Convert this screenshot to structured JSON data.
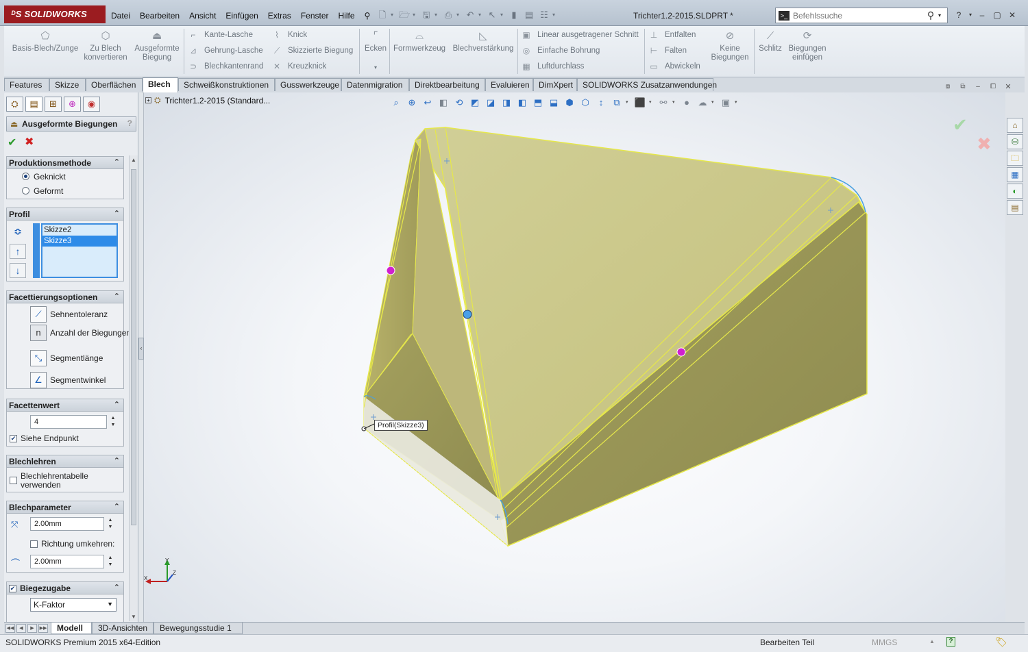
{
  "app": {
    "logo": "SOLIDWORKS",
    "menu": [
      "Datei",
      "Bearbeiten",
      "Ansicht",
      "Einfügen",
      "Extras",
      "Fenster",
      "Hilfe"
    ],
    "document_title": "Trichter1.2-2015.SLDPRT *",
    "search_placeholder": "Befehlssuche"
  },
  "ribbon": {
    "big_left": [
      {
        "label": "Basis-Blech/Zunge",
        "icon": "base-flange-icon"
      },
      {
        "label": "Zu Blech konvertieren",
        "icon": "convert-sheet-metal-icon"
      },
      {
        "label": "Ausgeformte Biegung",
        "icon": "lofted-bend-icon"
      }
    ],
    "col_flanges": [
      "Kante-Lasche",
      "Gehrung-Lasche",
      "Blechkantenrand"
    ],
    "col_bends": [
      "Knick",
      "Skizzierte Biegung",
      "Kreuzknick"
    ],
    "corners": "Ecken",
    "big_mid": [
      {
        "label": "Formwerkzeug",
        "icon": "forming-tool-icon"
      },
      {
        "label": "Blechverstärkung",
        "icon": "gusset-icon"
      }
    ],
    "col_cuts": [
      "Linear ausgetragener Schnitt",
      "Einfache Bohrung",
      "Luftdurchlass"
    ],
    "col_unfold": [
      "Entfalten",
      "Falten",
      "Abwickeln"
    ],
    "no_bends": "Keine Biegungen",
    "big_right": [
      {
        "label": "Schlitz",
        "icon": "rip-icon"
      },
      {
        "label": "Biegungen einfügen",
        "icon": "insert-bends-icon"
      }
    ]
  },
  "tabs": [
    "Features",
    "Skizze",
    "Oberflächen",
    "Blech",
    "Schweißkonstruktionen",
    "Gusswerkzeuge",
    "Datenmigration",
    "Direktbearbeitung",
    "Evaluieren",
    "DimXpert",
    "SOLIDWORKS Zusatzanwendungen"
  ],
  "active_tab": "Blech",
  "property_manager": {
    "title": "Ausgeformte Biegungen",
    "help": "?",
    "production_method": {
      "title": "Produktionsmethode",
      "options": [
        "Geknickt",
        "Geformt"
      ],
      "selected": "Geknickt"
    },
    "profile": {
      "title": "Profil",
      "items": [
        "Skizze2",
        "Skizze3"
      ],
      "selected": "Skizze3"
    },
    "faceting": {
      "title": "Facettierungsoptionen",
      "options": [
        "Sehnentoleranz",
        "Anzahl der Biegungen",
        "Segmentlänge",
        "Segmentwinkel"
      ]
    },
    "facet_value": {
      "title": "Facettenwert",
      "value": "4",
      "see_endpoint": "Siehe Endpunkt",
      "see_endpoint_checked": true
    },
    "gauges": {
      "title": "Blechlehren",
      "use_table": "Blechlehrentabelle verwenden"
    },
    "sheet_params": {
      "title": "Blechparameter",
      "thickness": "2.00mm",
      "reverse_direction": "Richtung umkehren:",
      "radius": "2.00mm"
    },
    "bend_allowance": {
      "title": "Biegezugabe",
      "type": "K-Faktor"
    }
  },
  "viewport": {
    "tree_root": "Trichter1.2-2015  (Standard...",
    "callout": "Profil(Skizze3)"
  },
  "bottom_tabs": [
    "Modell",
    "3D-Ansichten",
    "Bewegungsstudie 1"
  ],
  "active_bottom_tab": "Modell",
  "status": {
    "edition": "SOLIDWORKS Premium 2015 x64-Edition",
    "mode": "Bearbeiten Teil",
    "units": "MMGS"
  },
  "colors": {
    "model_face": "#c9c477",
    "model_edge": "#e6e84a",
    "accent": "#2e8be8",
    "logo_bg": "#9b1c20"
  }
}
